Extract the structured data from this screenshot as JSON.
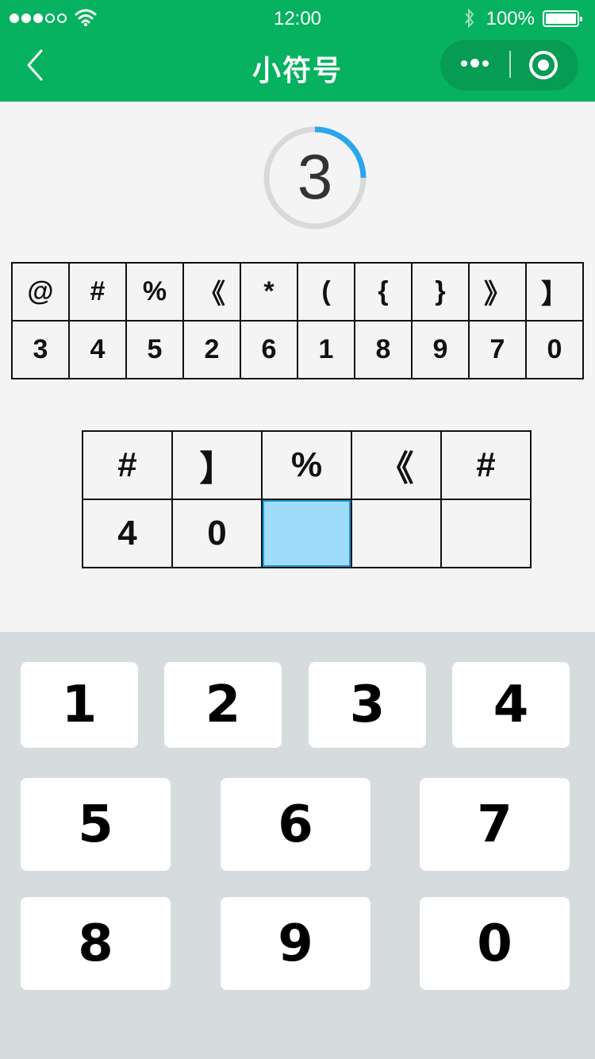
{
  "status_bar": {
    "signal_dots": [
      true,
      true,
      true,
      false,
      false
    ],
    "time": "12:00",
    "battery": "100%"
  },
  "nav": {
    "title": "小符号"
  },
  "timer": {
    "value": "3",
    "progress": 0.25,
    "accent_color": "#2aa6ee"
  },
  "key_table": {
    "symbols": [
      "@",
      "#",
      "%",
      "《",
      "*",
      "(",
      "{",
      "}",
      "》",
      "】"
    ],
    "digits": [
      "3",
      "4",
      "5",
      "2",
      "6",
      "1",
      "8",
      "9",
      "7",
      "0"
    ]
  },
  "question": {
    "symbols": [
      "#",
      "】",
      "%",
      "《",
      "#"
    ],
    "answers": [
      "4",
      "0",
      "",
      "",
      ""
    ],
    "active_index": 2
  },
  "keypad": {
    "row1": [
      "1",
      "2",
      "3",
      "4"
    ],
    "row2": [
      "5",
      "6",
      "7"
    ],
    "row3": [
      "8",
      "9",
      "0"
    ]
  },
  "colors": {
    "header": "#06b25f",
    "active_cell": "#9fdcfb",
    "keypad_bg": "#d6dbdd"
  }
}
